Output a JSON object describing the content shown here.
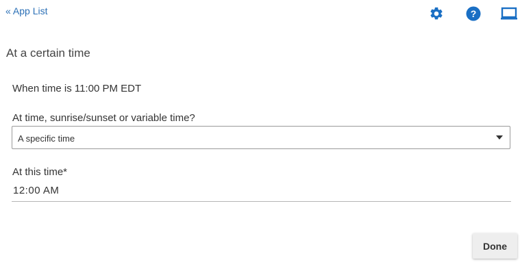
{
  "nav": {
    "back_label": "« App List"
  },
  "toolbar": {
    "icons": [
      "gear-icon",
      "help-icon",
      "screen-icon"
    ],
    "icon_color": "#1a6fc4"
  },
  "page": {
    "title": "At a certain time"
  },
  "trigger": {
    "summary": "When time is 11:00 PM EDT"
  },
  "time_type": {
    "label": "At time, sunrise/sunset or variable time?",
    "selected": "A specific time"
  },
  "time_field": {
    "label": "At this time*",
    "value": "12:00 AM"
  },
  "actions": {
    "done_label": "Done"
  }
}
